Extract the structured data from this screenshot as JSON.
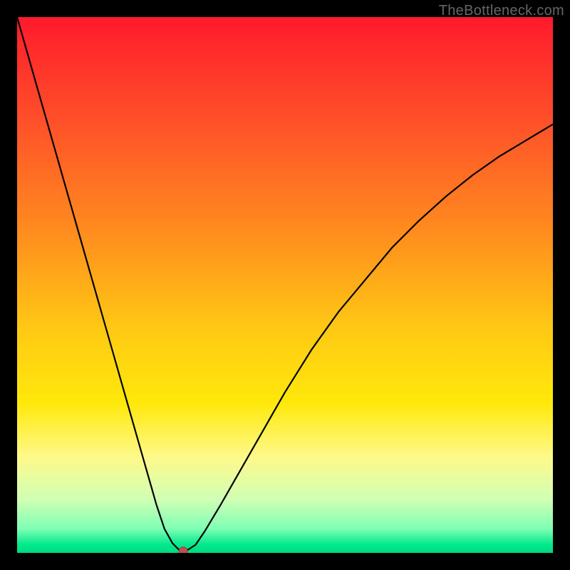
{
  "watermark": "TheBottleneck.com",
  "chart_data": {
    "type": "line",
    "title": "",
    "xlabel": "",
    "ylabel": "",
    "xlim": [
      0,
      100
    ],
    "ylim": [
      0,
      100
    ],
    "background_gradient": {
      "stops": [
        {
          "pos": 0.0,
          "color": "#ff1a2c"
        },
        {
          "pos": 0.18,
          "color": "#ff4c2a"
        },
        {
          "pos": 0.4,
          "color": "#ff8c1e"
        },
        {
          "pos": 0.58,
          "color": "#ffc814"
        },
        {
          "pos": 0.72,
          "color": "#ffe80a"
        },
        {
          "pos": 0.82,
          "color": "#fff98a"
        },
        {
          "pos": 0.9,
          "color": "#d0ffb4"
        },
        {
          "pos": 0.955,
          "color": "#7effb4"
        },
        {
          "pos": 0.985,
          "color": "#00e88c"
        },
        {
          "pos": 1.0,
          "color": "#00d97f"
        }
      ]
    },
    "series": [
      {
        "name": "bottleneck-curve",
        "color": "#000000",
        "x": [
          0,
          2,
          4,
          6,
          8,
          10,
          12,
          14,
          16,
          18,
          20,
          22,
          24,
          26,
          27.5,
          29,
          30.2,
          30.8,
          31.6,
          33.3,
          35,
          38,
          42,
          46,
          50,
          55,
          60,
          65,
          70,
          75,
          80,
          85,
          90,
          95,
          100
        ],
        "y": [
          100,
          93,
          86,
          79,
          72,
          65,
          58,
          51,
          44,
          37,
          30,
          23,
          16,
          9,
          4.5,
          1.8,
          0.6,
          0.3,
          0.4,
          1.5,
          4,
          9,
          16,
          23,
          30,
          38,
          45,
          51,
          57,
          62,
          66.5,
          70.5,
          74,
          77,
          80
        ]
      }
    ],
    "marker": {
      "name": "optimal-point",
      "x": 31.0,
      "y": 0.3,
      "color": "#c05050",
      "radius_px": 6
    }
  }
}
